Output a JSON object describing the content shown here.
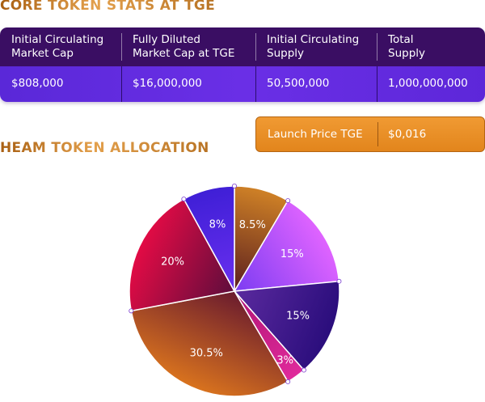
{
  "core_stats": {
    "title": "CORE TOKEN STATS AT TGE",
    "headers": [
      [
        "Initial Circulating",
        "Market Cap"
      ],
      [
        "Fully Diluted",
        "Market Cap at TGE"
      ],
      [
        "Initial Circulating",
        "Supply"
      ],
      [
        "Total",
        "Supply"
      ]
    ],
    "values": [
      "$808,000",
      "$16,000,000",
      "50,500,000",
      "1,000,000,000"
    ]
  },
  "launch_price": {
    "label": "Launch Price TGE",
    "value": "$0,016"
  },
  "allocation": {
    "title": "HEAM TOKEN ALLOCATION"
  },
  "chart_data": {
    "type": "pie",
    "slices": [
      {
        "label": "8.5%",
        "value": 8.5,
        "colors": [
          "#cf8126",
          "#5a1e1e"
        ]
      },
      {
        "label": "15%",
        "value": 15,
        "colors": [
          "#e064ff",
          "#7b3cf2"
        ]
      },
      {
        "label": "15%",
        "value": 15,
        "colors": [
          "#2a0d7c",
          "#5b2a9e"
        ]
      },
      {
        "label": "3%",
        "value": 3,
        "colors": [
          "#e02a9c",
          "#b01473"
        ]
      },
      {
        "label": "30.5%",
        "value": 30.5,
        "colors": [
          "#d9731e",
          "#6a1b2e"
        ]
      },
      {
        "label": "20%",
        "value": 20,
        "colors": [
          "#e30b45",
          "#5e0d3c"
        ]
      },
      {
        "label": "8%",
        "value": 8,
        "colors": [
          "#3f1fd6",
          "#6a2ff0"
        ]
      }
    ]
  }
}
